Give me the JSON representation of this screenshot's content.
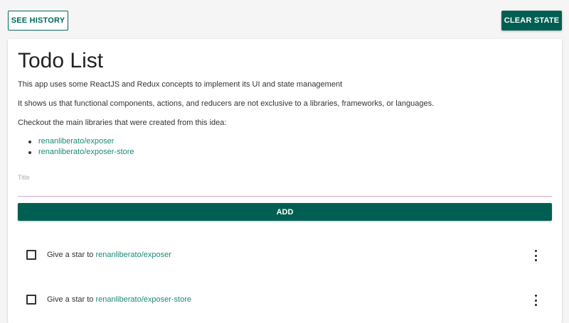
{
  "header": {
    "history_label": "SEE HISTORY",
    "clear_label": "CLEAR STATE"
  },
  "main": {
    "title": "Todo List",
    "paragraphs": [
      "This app uses some ReactJS and Redux concepts to implement its UI and state management",
      "It shows us that functional components, actions, and reducers are not exclusive to a libraries, frameworks, or languages.",
      "Checkout the main libraries that were created from this idea:"
    ],
    "links": [
      {
        "label": "renanliberato/exposer"
      },
      {
        "label": "renanliberato/exposer-store"
      }
    ]
  },
  "form": {
    "title_label": "Title",
    "title_value": "",
    "add_label": "ADD"
  },
  "todos": [
    {
      "prefix": "Give a star to ",
      "link": "renanliberato/exposer",
      "checked": false
    },
    {
      "prefix": "Give a star to ",
      "link": "renanliberato/exposer-store",
      "checked": false
    }
  ],
  "colors": {
    "primary": "#005f52",
    "link": "#1a8a76",
    "input_underline": "#d8a7c4",
    "background": "#f5f5f5"
  },
  "icons": {
    "todo_menu": "more-vert-icon"
  }
}
